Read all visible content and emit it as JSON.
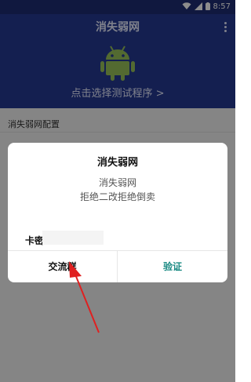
{
  "status_bar": {
    "time": "8:57",
    "icons": [
      "wifi-icon",
      "signal-icon",
      "battery-icon"
    ]
  },
  "app_bar": {
    "title": "消失弱网",
    "select_prompt": "点击选择测试程序 >",
    "menu_icon": "more-vert-icon",
    "logo_icon": "android-icon"
  },
  "content": {
    "section_title": "消失弱网配置"
  },
  "dialog": {
    "title": "消失弱网",
    "message_line1": "消失弱网",
    "message_line2": "拒绝二改拒绝倒卖",
    "key_label": "卡密",
    "key_value": "",
    "left_button": "交流群",
    "right_button": "验证"
  },
  "colors": {
    "app_bar": "#253a93",
    "status_bar": "#1e2c73",
    "accent": "#1a8a83",
    "annotation_arrow": "#e02020"
  }
}
